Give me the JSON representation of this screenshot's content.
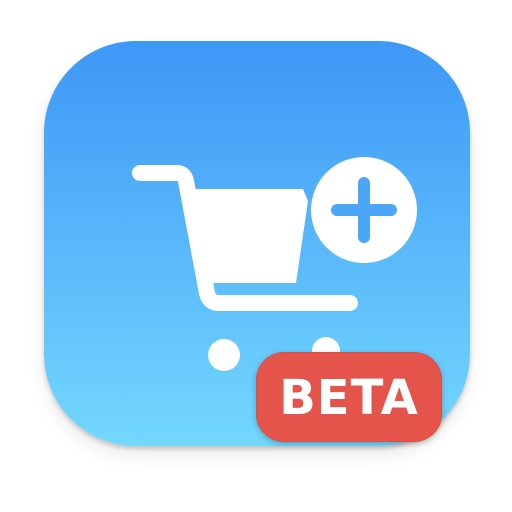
{
  "app_icon": {
    "gradient_top": "#3D97F7",
    "gradient_bottom": "#73D8FD",
    "glyph_color": "#FFFFFF",
    "cart_icon": "shopping-cart-icon",
    "add_icon": "plus-circle-icon"
  },
  "badge": {
    "label": "BETA",
    "color": "#E5544A",
    "text_color": "#FFFFFF"
  }
}
